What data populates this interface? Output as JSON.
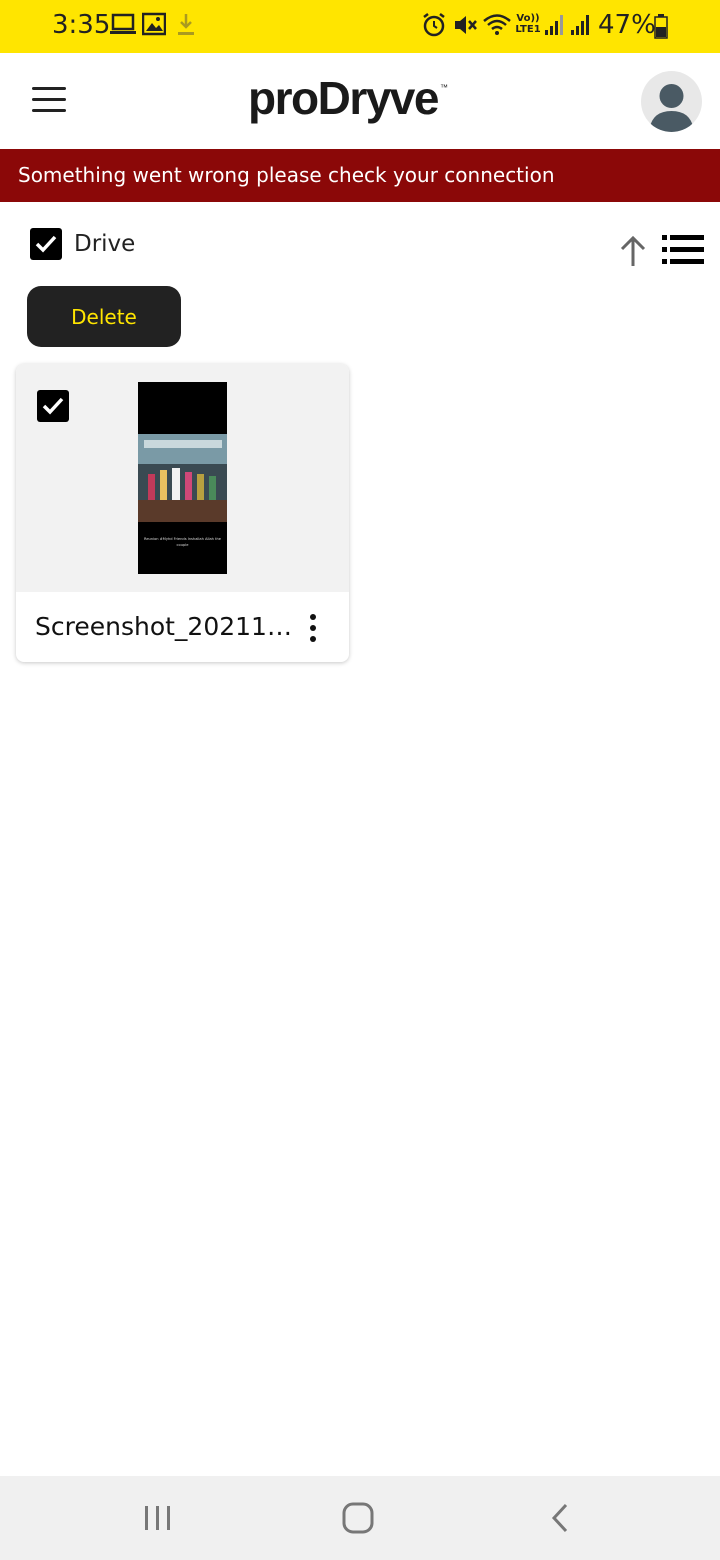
{
  "status_bar": {
    "time": "3:35",
    "battery": "47%",
    "background": "#FFE500",
    "left_icons": [
      "laptop-icon",
      "image-icon",
      "download-icon"
    ],
    "right_icons": [
      "alarm-icon",
      "mute-icon",
      "wifi-icon",
      "volte-icon",
      "signal-icon",
      "signal-icon",
      "battery-icon"
    ],
    "network_label": "Vo)) LTE1"
  },
  "app_bar": {
    "logo": "proDryve",
    "logo_mark": "™",
    "menu_icon": "hamburger-menu-icon",
    "avatar_icon": "user-avatar-icon"
  },
  "error_banner": {
    "message": "Something went wrong please check your connection",
    "background": "#8B0808"
  },
  "toolbar": {
    "folder_title": "Drive",
    "select_all_checked": true,
    "sort_icon": "arrow-up-icon",
    "view_icon": "list-view-icon",
    "delete_label": "Delete",
    "accent": "#FFE500"
  },
  "files": [
    {
      "name": "Screenshot_2021112...",
      "checked": true,
      "thumbnail_caption": "Reunion #Myhd Friends Inshallah Allah the couple",
      "menu_icon": "more-vert-icon"
    }
  ],
  "nav_bar": {
    "recents_icon": "recents-icon",
    "home_icon": "home-icon",
    "back_icon": "back-icon"
  }
}
